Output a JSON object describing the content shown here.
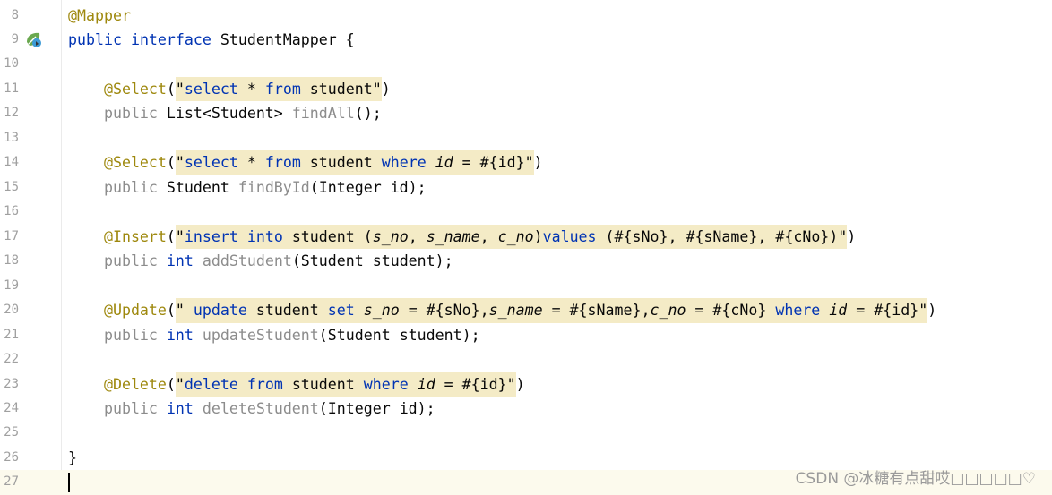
{
  "editor": {
    "current_line": "27",
    "lines": [
      {
        "n": "8",
        "tokens": [
          [
            "@Mapper",
            "ann"
          ]
        ]
      },
      {
        "n": "9",
        "icon": "spring-bean-gutter-icon",
        "tokens": [
          [
            "public",
            "kw"
          ],
          [
            " ",
            ""
          ],
          [
            "interface",
            "kw"
          ],
          [
            " StudentMapper {",
            ""
          ]
        ]
      },
      {
        "n": "10",
        "tokens": []
      },
      {
        "n": "11",
        "tokens": [
          [
            "    ",
            ""
          ],
          [
            "@Select",
            "ann"
          ],
          [
            "(",
            ""
          ],
          [
            "\"",
            "hl"
          ],
          [
            "select",
            "kw hl"
          ],
          [
            " * ",
            "hl"
          ],
          [
            "from",
            "kw hl"
          ],
          [
            " student",
            "hl"
          ],
          [
            "\"",
            "hl"
          ],
          [
            ")",
            ""
          ]
        ]
      },
      {
        "n": "12",
        "tokens": [
          [
            "    ",
            ""
          ],
          [
            "public",
            "gray"
          ],
          [
            " List<Student> ",
            ""
          ],
          [
            "findAll",
            "gray"
          ],
          [
            "();",
            ""
          ]
        ]
      },
      {
        "n": "13",
        "tokens": []
      },
      {
        "n": "14",
        "tokens": [
          [
            "    ",
            ""
          ],
          [
            "@Select",
            "ann"
          ],
          [
            "(",
            ""
          ],
          [
            "\"",
            "hl"
          ],
          [
            "select",
            "kw hl"
          ],
          [
            " * ",
            "hl"
          ],
          [
            "from",
            "kw hl"
          ],
          [
            " student ",
            "hl"
          ],
          [
            "where",
            "kw hl"
          ],
          [
            " ",
            "hl"
          ],
          [
            "id",
            "it hl"
          ],
          [
            " = #{id}",
            "hl"
          ],
          [
            "\"",
            "hl"
          ],
          [
            ")",
            ""
          ]
        ]
      },
      {
        "n": "15",
        "tokens": [
          [
            "    ",
            ""
          ],
          [
            "public",
            "gray"
          ],
          [
            " Student ",
            ""
          ],
          [
            "findById",
            "gray"
          ],
          [
            "(Integer id);",
            ""
          ]
        ]
      },
      {
        "n": "16",
        "tokens": []
      },
      {
        "n": "17",
        "tokens": [
          [
            "    ",
            ""
          ],
          [
            "@Insert",
            "ann"
          ],
          [
            "(",
            ""
          ],
          [
            "\"",
            "hl"
          ],
          [
            "insert",
            "kw hl"
          ],
          [
            " ",
            "hl"
          ],
          [
            "into",
            "kw hl"
          ],
          [
            " student (",
            "hl"
          ],
          [
            "s_no",
            "it hl"
          ],
          [
            ", ",
            "hl"
          ],
          [
            "s_name",
            "it hl"
          ],
          [
            ", ",
            "hl"
          ],
          [
            "c_no",
            "it hl"
          ],
          [
            ")",
            "hl"
          ],
          [
            "values",
            "kw hl"
          ],
          [
            " (#{sNo}, #{sName}, #{cNo})",
            "hl"
          ],
          [
            "\"",
            "hl"
          ],
          [
            ")",
            ""
          ]
        ]
      },
      {
        "n": "18",
        "tokens": [
          [
            "    ",
            ""
          ],
          [
            "public",
            "gray"
          ],
          [
            " ",
            ""
          ],
          [
            "int",
            "kw"
          ],
          [
            " ",
            ""
          ],
          [
            "addStudent",
            "gray"
          ],
          [
            "(Student student);",
            ""
          ]
        ]
      },
      {
        "n": "19",
        "tokens": []
      },
      {
        "n": "20",
        "tokens": [
          [
            "    ",
            ""
          ],
          [
            "@Update",
            "ann"
          ],
          [
            "(",
            ""
          ],
          [
            "\" ",
            "hl"
          ],
          [
            "update",
            "kw hl"
          ],
          [
            " student ",
            "hl"
          ],
          [
            "set",
            "kw hl"
          ],
          [
            " ",
            "hl"
          ],
          [
            "s_no",
            "it hl"
          ],
          [
            " = #{sNo},",
            "hl"
          ],
          [
            "s_name",
            "it hl"
          ],
          [
            " = #{sName},",
            "hl"
          ],
          [
            "c_no",
            "it hl"
          ],
          [
            " = #{cNo} ",
            "hl"
          ],
          [
            "where",
            "kw hl"
          ],
          [
            " ",
            "hl"
          ],
          [
            "id",
            "it hl"
          ],
          [
            " = #{id}",
            "hl"
          ],
          [
            "\"",
            "hl"
          ],
          [
            ")",
            ""
          ]
        ]
      },
      {
        "n": "21",
        "tokens": [
          [
            "    ",
            ""
          ],
          [
            "public",
            "gray"
          ],
          [
            " ",
            ""
          ],
          [
            "int",
            "kw"
          ],
          [
            " ",
            ""
          ],
          [
            "updateStudent",
            "gray"
          ],
          [
            "(Student student);",
            ""
          ]
        ]
      },
      {
        "n": "22",
        "tokens": []
      },
      {
        "n": "23",
        "tokens": [
          [
            "    ",
            ""
          ],
          [
            "@Delete",
            "ann"
          ],
          [
            "(",
            ""
          ],
          [
            "\"",
            "hl"
          ],
          [
            "delete",
            "kw hl"
          ],
          [
            " ",
            "hl"
          ],
          [
            "from",
            "kw hl"
          ],
          [
            " student ",
            "hl"
          ],
          [
            "where",
            "kw hl"
          ],
          [
            " ",
            "hl"
          ],
          [
            "id",
            "it hl"
          ],
          [
            " = #{id}",
            "hl"
          ],
          [
            "\"",
            "hl"
          ],
          [
            ")",
            ""
          ]
        ]
      },
      {
        "n": "24",
        "tokens": [
          [
            "    ",
            ""
          ],
          [
            "public",
            "gray"
          ],
          [
            " ",
            ""
          ],
          [
            "int",
            "kw"
          ],
          [
            " ",
            ""
          ],
          [
            "deleteStudent",
            "gray"
          ],
          [
            "(Integer id);",
            ""
          ]
        ]
      },
      {
        "n": "25",
        "tokens": []
      },
      {
        "n": "26",
        "tokens": [
          [
            "}",
            ""
          ]
        ]
      },
      {
        "n": "27",
        "tokens": []
      }
    ]
  },
  "watermark": "CSDN @冰糖有点甜哎□□□□□♡",
  "colors": {
    "annotation": "#9e880d",
    "keyword": "#0033b3",
    "injected_bg": "#f4ebc6",
    "current_line_bg": "#fcfaed"
  }
}
